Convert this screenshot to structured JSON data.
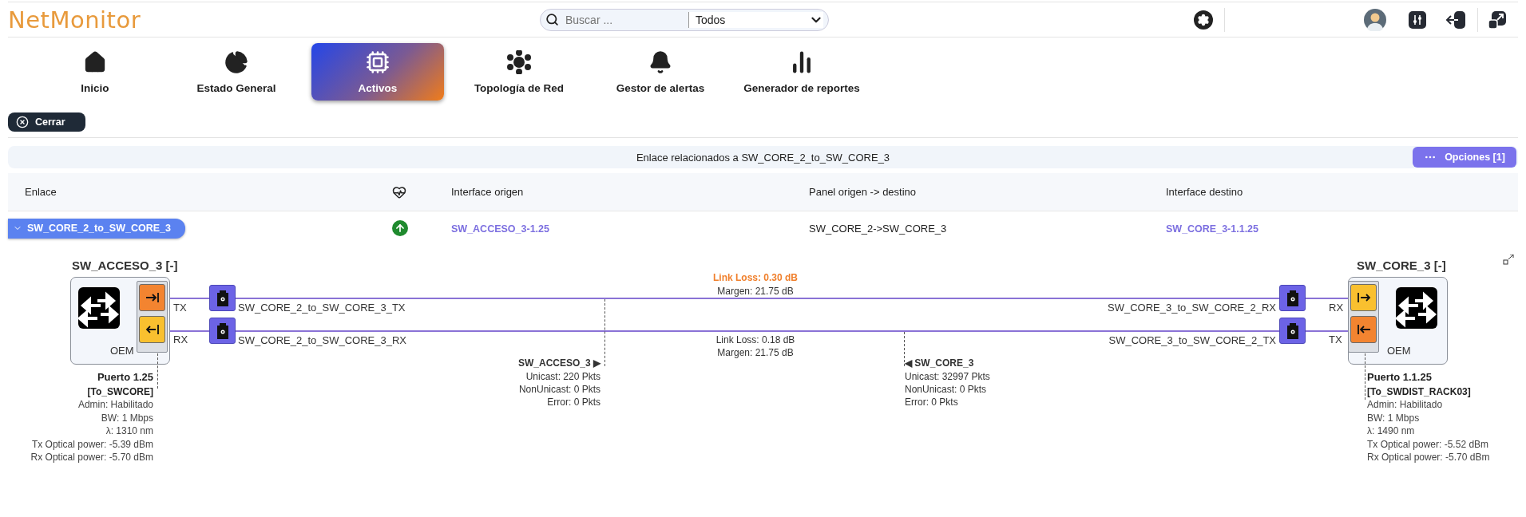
{
  "header": {
    "logo": "NetMonitor",
    "search": {
      "placeholder": "Buscar ..."
    },
    "filter": {
      "value": "Todos"
    }
  },
  "nav": [
    {
      "label": "Inicio",
      "selected": false
    },
    {
      "label": "Estado General",
      "selected": false
    },
    {
      "label": "Activos",
      "selected": true
    },
    {
      "label": "Topología de Red",
      "selected": false
    },
    {
      "label": "Gestor de alertas",
      "selected": false
    },
    {
      "label": "Generador de reportes",
      "selected": false
    }
  ],
  "close_button": "Cerrar",
  "panel": {
    "title": "Enlace relacionados a SW_CORE_2_to_SW_CORE_3",
    "options_button": "Opciones [1]"
  },
  "table": {
    "columns": [
      "Enlace",
      "Interface origen",
      "Panel origen -> destino",
      "Interface destino"
    ],
    "rows": [
      {
        "enlace": "SW_CORE_2_to_SW_CORE_3",
        "expanded": true,
        "origen": "SW_ACCESO_3-1.25",
        "panel": "SW_CORE_2->SW_CORE_3",
        "destino": "SW_CORE_3-1.1.25"
      }
    ]
  },
  "diagram": {
    "left_device": {
      "name": "SW_ACCESO_3 [-]",
      "vendor": "OEM",
      "ports": [
        {
          "label": "TX",
          "kind": "tx"
        },
        {
          "label": "RX",
          "kind": "rx"
        }
      ],
      "port_info": {
        "title": "Puerto 1.25",
        "alias": "[To_SWCORE]",
        "lines": [
          "Admin: Habilitado",
          "BW: 1 Mbps",
          "λ: 1310 nm",
          "Tx Optical power: -5.39 dBm",
          "Rx Optical power: -5.70 dBm"
        ]
      }
    },
    "right_device": {
      "name": "SW_CORE_3 [-]",
      "vendor": "OEM",
      "ports": [
        {
          "label": "RX",
          "kind": "rx"
        },
        {
          "label": "TX",
          "kind": "tx"
        }
      ],
      "port_info": {
        "title": "Puerto 1.1.25",
        "alias": "[To_SWDIST_RACK03]",
        "lines": [
          "Admin: Habilitado",
          "BW: 1 Mbps",
          "λ: 1490 nm",
          "Tx Optical power: -5.52 dBm",
          "Rx Optical power: -5.70 dBm"
        ]
      }
    },
    "links": [
      {
        "cable_left": "SW_CORE_2_to_SW_CORE_3_TX",
        "cable_right": "SW_CORE_3_to_SW_CORE_2_RX",
        "loss": "Link Loss: 0.30 dB",
        "alert": true,
        "margin": "Margen: 21.75 dB"
      },
      {
        "cable_left": "SW_CORE_2_to_SW_CORE_3_RX",
        "cable_right": "SW_CORE_3_to_SW_CORE_2_TX",
        "loss": "Link Loss: 0.18 dB",
        "alert": false,
        "margin": "Margen: 21.75 dB"
      }
    ],
    "stats": [
      {
        "device": "SW_ACCESO_3 ▶",
        "lines": [
          "Unicast: 220 Pkts",
          "NonUnicast: 0 Pkts",
          "Error: 0 Pkts"
        ]
      },
      {
        "device": "◀ SW_CORE_3",
        "lines": [
          "Unicast: 32997 Pkts",
          "NonUnicast: 0 Pkts",
          "Error: 0 Pkts"
        ]
      }
    ]
  }
}
